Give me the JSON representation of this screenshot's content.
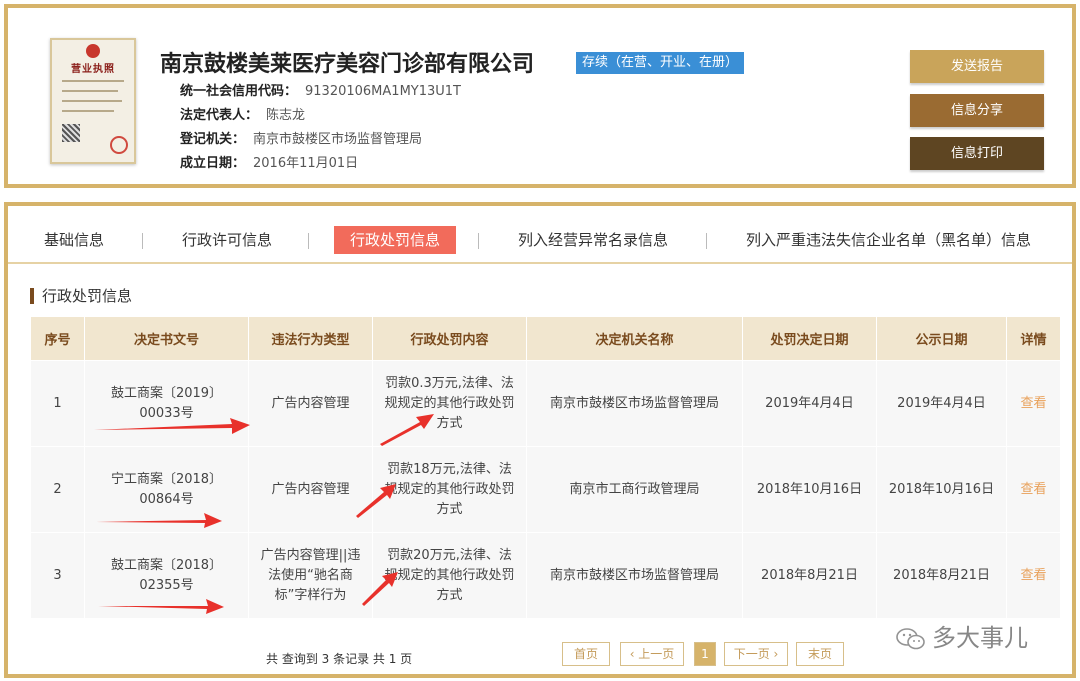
{
  "company": {
    "license_title": "营业执照",
    "name": "南京鼓楼美莱医疗美容门诊部有限公司",
    "status": "存续（在营、开业、在册）",
    "fields": [
      {
        "label": "统一社会信用代码：",
        "value": "91320106MA1MY13U1T"
      },
      {
        "label": "法定代表人：",
        "value": "陈志龙"
      },
      {
        "label": "登记机关：",
        "value": "南京市鼓楼区市场监督管理局"
      },
      {
        "label": "成立日期：",
        "value": "2016年11月01日"
      }
    ]
  },
  "actions": {
    "send_report": "发送报告",
    "share": "信息分享",
    "print": "信息打印"
  },
  "tabs": [
    {
      "label": "基础信息",
      "active": false
    },
    {
      "label": "行政许可信息",
      "active": false
    },
    {
      "label": "行政处罚信息",
      "active": true
    },
    {
      "label": "列入经营异常名录信息",
      "active": false
    },
    {
      "label": "列入严重违法失信企业名单（黑名单）信息",
      "active": false
    }
  ],
  "section_title": "行政处罚信息",
  "table": {
    "headers": [
      "序号",
      "决定书文号",
      "违法行为类型",
      "行政处罚内容",
      "决定机关名称",
      "处罚决定日期",
      "公示日期",
      "详情"
    ],
    "rows": [
      [
        "1",
        "鼓工商案〔2019〕00033号",
        "广告内容管理",
        "罚款0.3万元,法律、法规规定的其他行政处罚方式",
        "南京市鼓楼区市场监督管理局",
        "2019年4月4日",
        "2019年4月4日",
        "查看"
      ],
      [
        "2",
        "宁工商案〔2018〕00864号",
        "广告内容管理",
        "罚款18万元,法律、法规规定的其他行政处罚方式",
        "南京市工商行政管理局",
        "2018年10月16日",
        "2018年10月16日",
        "查看"
      ],
      [
        "3",
        "鼓工商案〔2018〕02355号",
        "广告内容管理||违法使用“驰名商标”字样行为",
        "罚款20万元,法律、法规规定的其他行政处罚方式",
        "南京市鼓楼区市场监督管理局",
        "2018年8月21日",
        "2018年8月21日",
        "查看"
      ]
    ]
  },
  "footer": {
    "count_text": "共 查询到 3 条记录 共 1 页",
    "first": "首页",
    "prev": "‹ 上一页",
    "current": "1",
    "next": "下一页 ›",
    "last": "末页"
  },
  "watermark": "多大事儿",
  "colors": {
    "border_gold": "#d6b36a",
    "active_tab": "#f26b5b",
    "status_blue": "#3a8fd6",
    "arrow_red": "#e8312b"
  }
}
